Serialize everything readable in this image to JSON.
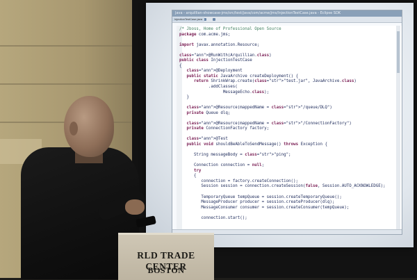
{
  "ide": {
    "title": "Java - arquillian-showcase-jms/src/test/java/com/acme/jms/InjectionTestCase.java - Eclipse SDK",
    "tab": "InjectionTestCase.java",
    "code_lines": [
      "/* Jboss, Home of Professional Open Source",
      "package com.acme.jms;",
      "",
      "import javax.annotation.Resource;",
      "",
      "@RunWith(Arquillian.class)",
      "public class InjectionTestCase",
      "{",
      "   @Deployment",
      "   public static JavaArchive createDeployment() {",
      "      return ShrinkWrap.create(\"test.jar\", JavaArchive.class)",
      "            .addClasses(",
      "                  MessageEcho.class);",
      "   }",
      "",
      "   @Resource(mappedName = \"/queue/DLQ\")",
      "   private Queue dlq;",
      "",
      "   @Resource(mappedName = \"/ConnectionFactory\")",
      "   private ConnectionFactory factory;",
      "",
      "   @Test",
      "   public void shouldBeAbleToSendMessage() throws Exception {",
      "",
      "      String messageBody = \"ping\";",
      "",
      "      Connection connection = null;",
      "      try",
      "      {",
      "         connection = factory.createConnection();",
      "         Session session = connection.createSession(false, Session.AUTO_ACKNOWLEDGE);",
      "",
      "         TemporaryQueue tempQueue = session.createTemporaryQueue();",
      "         MessageProducer producer = session.createProducer(dlq);",
      "         MessageConsumer consumer = session.createConsumer(tempQueue);",
      "",
      "         connection.start();",
      ""
    ]
  },
  "podium": {
    "line1": "RLD TRADE CENTER",
    "line2": "BOSTON"
  }
}
